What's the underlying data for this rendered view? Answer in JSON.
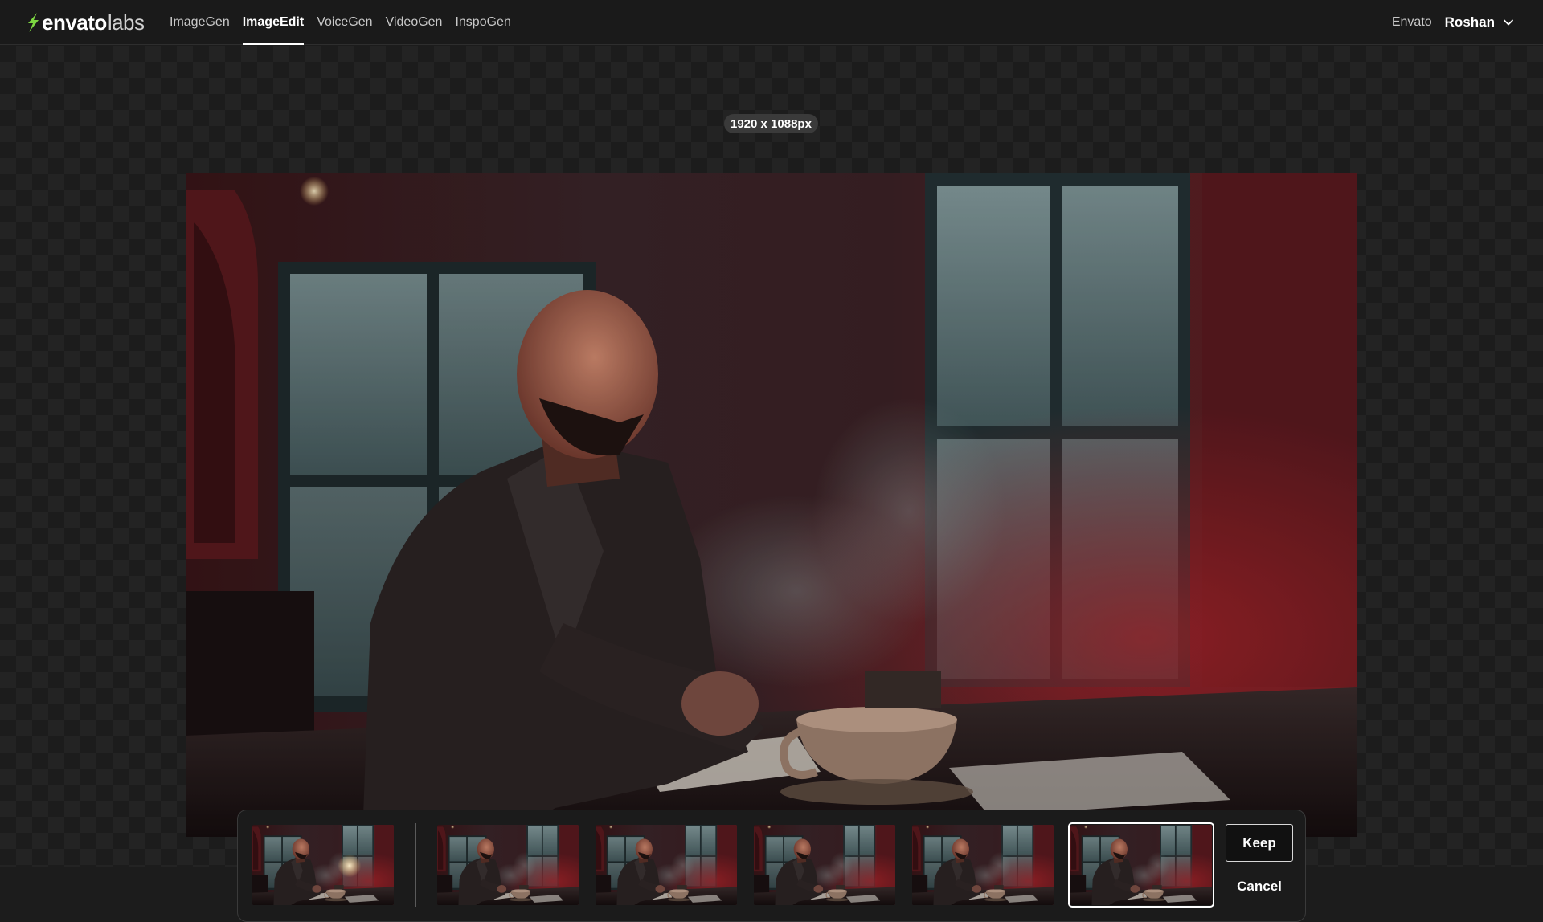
{
  "brand": {
    "word1": "envato",
    "word2": "labs",
    "accent": "#7cd641"
  },
  "nav": {
    "tabs": [
      {
        "label": "ImageGen",
        "active": false
      },
      {
        "label": "ImageEdit",
        "active": true
      },
      {
        "label": "VoiceGen",
        "active": false
      },
      {
        "label": "VideoGen",
        "active": false
      },
      {
        "label": "InspoGen",
        "active": false
      }
    ]
  },
  "account": {
    "envato_link": "Envato",
    "user_name": "Roshan",
    "menu_icon": "chevron-down-icon"
  },
  "canvas": {
    "dimensions_label": "1920 x 1088px",
    "image_description_icon": "photo-preview"
  },
  "variations": {
    "thumbnails": [
      {
        "name": "original",
        "selected": false
      },
      {
        "name": "variation-1",
        "selected": false
      },
      {
        "name": "variation-2",
        "selected": false
      },
      {
        "name": "variation-3",
        "selected": false
      },
      {
        "name": "variation-4",
        "selected": false
      },
      {
        "name": "variation-5",
        "selected": true
      }
    ],
    "keep_label": "Keep",
    "cancel_label": "Cancel"
  },
  "colors": {
    "background": "#1c1c1c",
    "nav_active": "#ffffff",
    "nav_inactive": "#c8c8c8",
    "scene_red": "#8a2a2e",
    "scene_teal": "#5f7f84"
  }
}
